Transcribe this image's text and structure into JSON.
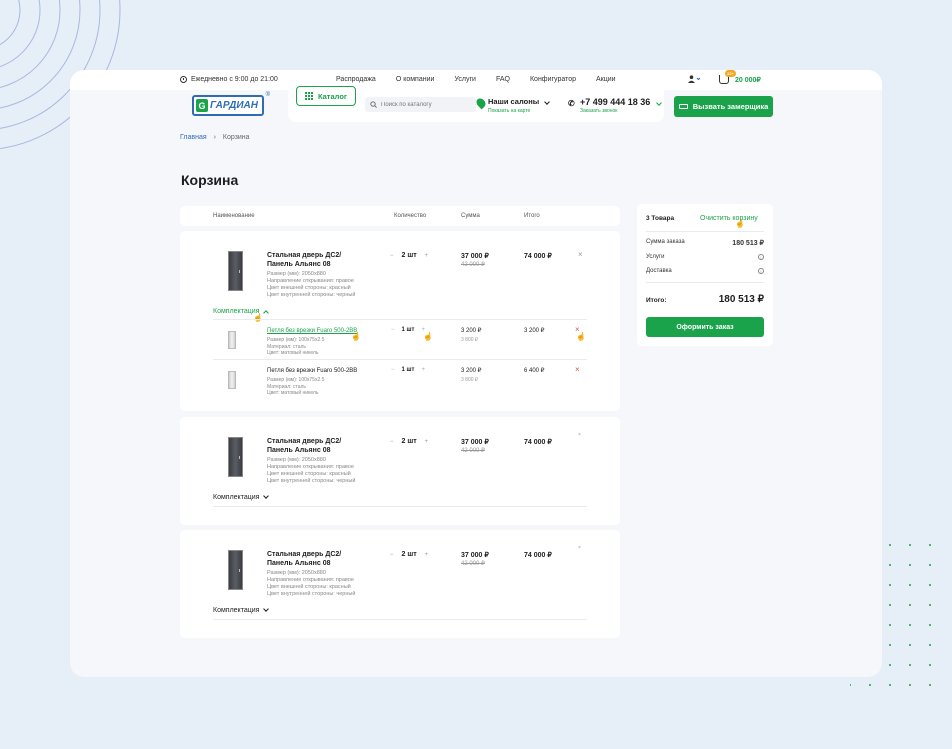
{
  "topbar": {
    "hours": "Ежедневно с 9:00 до 21:00",
    "nav": [
      "Распродажа",
      "О компании",
      "Услуги",
      "FAQ",
      "Конфигуратор",
      "Акции"
    ],
    "cart_badge": "12+",
    "cart_sum": "20 000₽"
  },
  "header": {
    "logo_text": "ГАРДИАН",
    "logo_letter": "G",
    "logo_reg": "®",
    "catalog_label": "Каталог",
    "search_placeholder": "Поиск по каталогу",
    "salons_label": "Наши салоны",
    "salons_sub": "Показать на карте",
    "phone": "+7 499 444 18 36",
    "phone_sub": "Заказать звонок",
    "measure_label": "Вызвать замерщика"
  },
  "breadcrumb": {
    "home": "Главная",
    "sep": "›",
    "current": "Корзина"
  },
  "page_title": "Корзина",
  "table_headers": {
    "name": "Наименование",
    "qty": "Количество",
    "sum": "Сумма",
    "total": "Итого"
  },
  "items": [
    {
      "title": "Стальная дверь ДС2/ Панель Альянс 08",
      "specs": [
        "Размер (мм): 2050х880",
        "Направление открывания: правое",
        "Цвет внешней стороны: красный",
        "Цвет внутренней стороны: черный"
      ],
      "qty": "2 шт",
      "price": "37 000 ₽",
      "old_price": "42 000 ₽",
      "total": "74 000 ₽",
      "kompl_label": "Комплектация",
      "sub_items": [
        {
          "title": "Петля без врезки Fuaro 500-2BB",
          "specs": [
            "Размер (мм): 100х75х2.5",
            "Материал: сталь",
            "Цвет: матовый никель"
          ],
          "qty": "1 шт",
          "price": "3 200 ₽",
          "old_price": "3 800 ₽",
          "total": "3 200 ₽"
        },
        {
          "title": "Петля без врезки Fuaro 500-2BB",
          "specs": [
            "Размер (мм): 100х75х2.5",
            "Материал: сталь",
            "Цвет: матовый никель"
          ],
          "qty": "1 шт",
          "price": "3 200 ₽",
          "old_price": "3 800 ₽",
          "total": "6 400 ₽"
        }
      ]
    },
    {
      "title": "Стальная дверь ДС2/ Панель Альянс 08",
      "specs": [
        "Размер (мм): 2050х880",
        "Направление открывания: правое",
        "Цвет внешней стороны: красный",
        "Цвет внутренней стороны: черный"
      ],
      "qty": "2 шт",
      "price": "37 000 ₽",
      "old_price": "42 000 ₽",
      "total": "74 000 ₽",
      "kompl_label": "Комплектация"
    },
    {
      "title": "Стальная дверь ДС2/ Панель Альянс 08",
      "specs": [
        "Размер (мм): 2050х880",
        "Направление открывания: правое",
        "Цвет внешней стороны: красный",
        "Цвет внутренней стороны: черный"
      ],
      "qty": "2 шт",
      "price": "37 000 ₽",
      "old_price": "42 000 ₽",
      "total": "74 000 ₽",
      "kompl_label": "Комплектация"
    }
  ],
  "summary": {
    "count": "3 Товара",
    "clear_label": "Очистить корзину",
    "order_sum_label": "Сумма заказа",
    "order_sum": "180 513 ₽",
    "services_label": "Услуги",
    "delivery_label": "Доставка",
    "total_label": "Итого:",
    "total": "180 513 ₽",
    "order_button": "Оформить заказ"
  },
  "icons": {
    "remove": "×",
    "minus": "−",
    "plus": "+",
    "info": "i",
    "cursor": "☝"
  },
  "colors": {
    "accent": "#1aa34a",
    "brand": "#2f6bb7",
    "badge": "#f5a623",
    "danger": "#e05252"
  }
}
